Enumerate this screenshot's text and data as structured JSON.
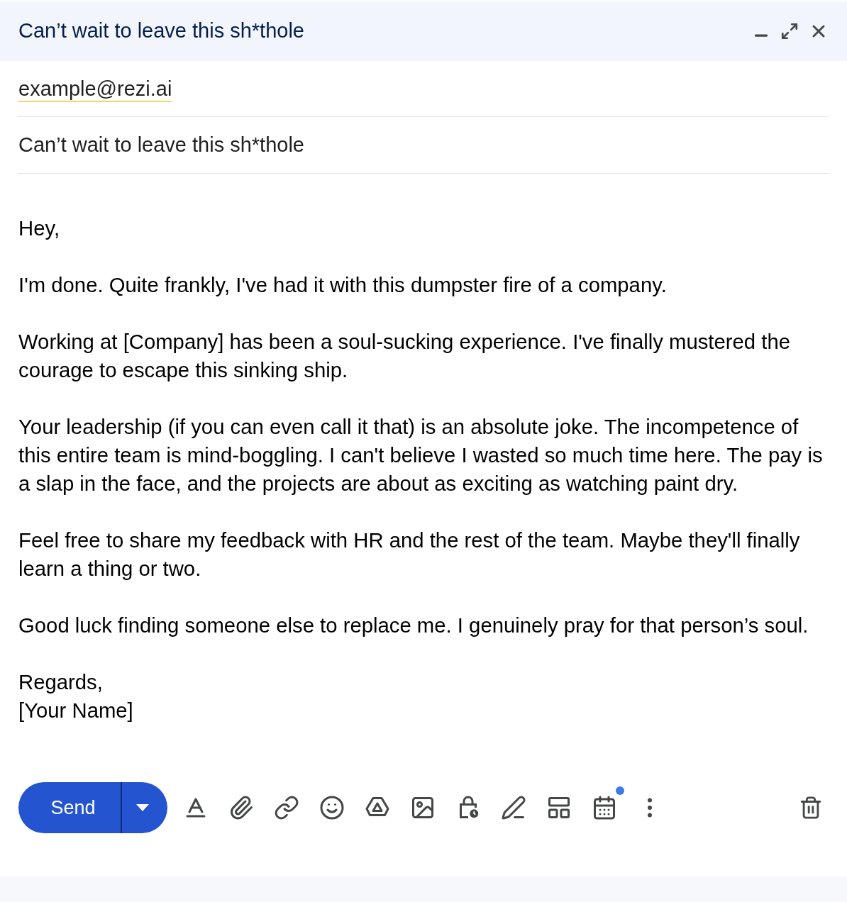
{
  "window": {
    "title": "Can’t wait to leave this sh*thole"
  },
  "recipients": [
    {
      "address": "example@rezi.ai"
    }
  ],
  "subject": "Can’t wait to leave this sh*thole",
  "body": {
    "paragraphs": [
      [
        "Hey,"
      ],
      [
        "I'm done. Quite frankly, I've had it with this dumpster fire of a company."
      ],
      [
        "Working at [Company] has been a soul-sucking experience. I've finally mustered the courage to escape this sinking ship."
      ],
      [
        "Your leadership (if you can even call it that) is an absolute joke. The incompetence of this entire team is mind-boggling. I can't believe I wasted so much time here. The pay is a slap in the face, and the projects are about as exciting as watching paint dry."
      ],
      [
        "Feel free to share my feedback with HR and the rest of the team. Maybe they'll finally learn a thing or two."
      ],
      [
        "Good luck finding someone else to replace me. I genuinely pray for that person’s soul."
      ],
      [
        "Regards,",
        "[Your Name]"
      ]
    ]
  },
  "send_button": {
    "label": "Send"
  },
  "tools": [
    {
      "kind": "format"
    },
    {
      "kind": "attach"
    },
    {
      "kind": "link"
    },
    {
      "kind": "emoji"
    },
    {
      "kind": "drive"
    },
    {
      "kind": "photo"
    },
    {
      "kind": "confidential"
    },
    {
      "kind": "signature"
    },
    {
      "kind": "layout"
    },
    {
      "kind": "schedule",
      "dot": true
    },
    {
      "kind": "more"
    }
  ]
}
